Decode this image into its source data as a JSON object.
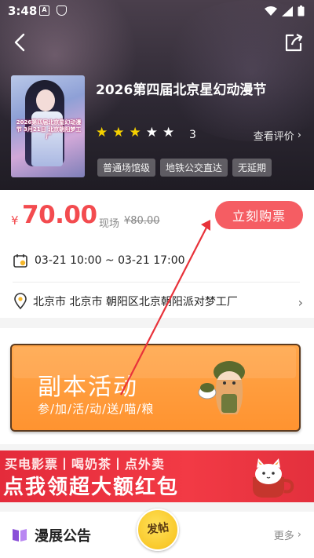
{
  "status_bar": {
    "time": "3:48",
    "icon_a": "A"
  },
  "event": {
    "title": "2026第四届北京星幻动漫节",
    "rating_count": "3",
    "review_link": "查看评价",
    "tags": [
      "普通场馆级",
      "地铁公交直达",
      "无延期"
    ],
    "poster_text": "2026第四届北京星幻动漫节 3月21日 北京朝阳梦工厂",
    "rating_stars": 3
  },
  "price": {
    "currency": "¥",
    "amount": "70.00",
    "orig_label": "现场",
    "orig_price": "¥80.00"
  },
  "buy_button": "立刻购票",
  "time": "03-21 10:00 ~ 03-21 17:00",
  "location": "北京市 北京市 朝阳区北京朝阳派对梦工厂",
  "activity": {
    "title": "副本活动",
    "subtitle": "参/加/活/动/送/喵/粮"
  },
  "promo": {
    "line1": "买电影票丨喝奶茶丨点外卖",
    "line2": "点我领超大额红包"
  },
  "notice": {
    "title": "漫展公告",
    "more": "更多"
  },
  "post_fab": "发帖",
  "colors": {
    "accent": "#f55d63",
    "price": "#f34b4f",
    "star_on": "#f5d100",
    "star_off": "#ffffff",
    "arrow": "#e8323a"
  }
}
